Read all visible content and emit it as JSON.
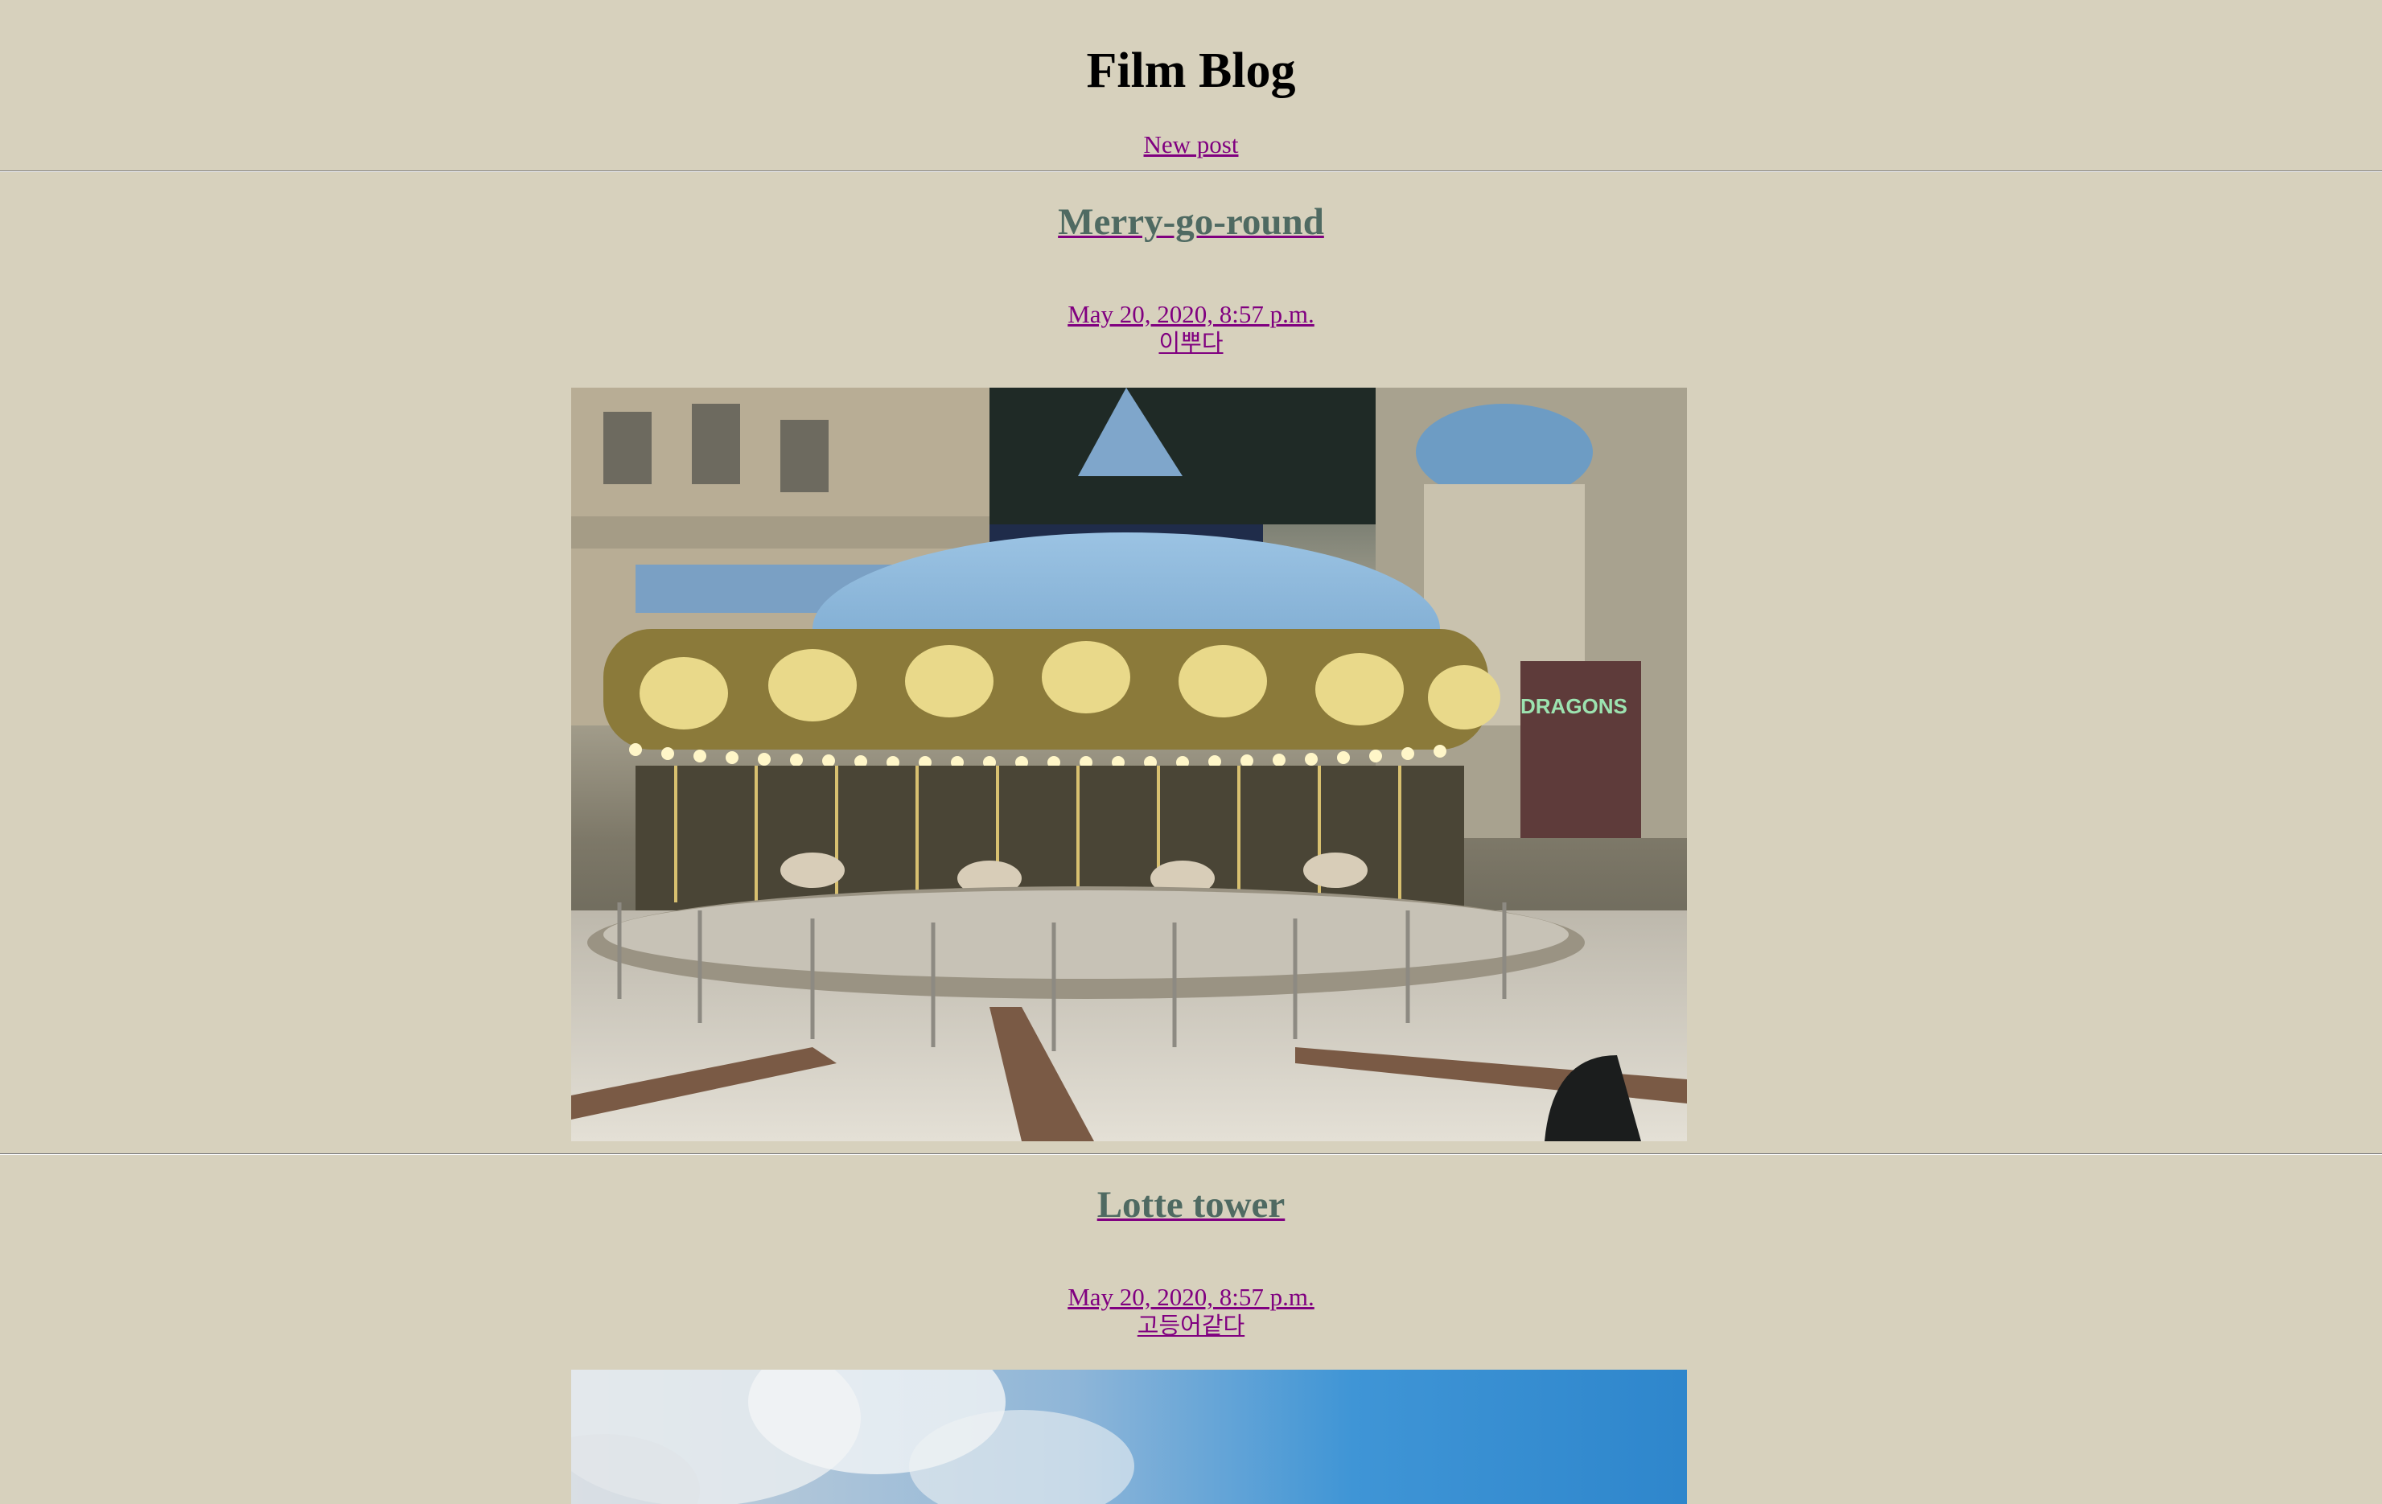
{
  "site": {
    "title": "Film Blog",
    "new_post_label": "New post"
  },
  "posts": [
    {
      "title": "Merry-go-round",
      "date": "May 20, 2020, 8:57 p.m.",
      "caption": "이뿌다",
      "photo_alt": "carousel"
    },
    {
      "title": "Lotte tower",
      "date": "May 20, 2020, 8:57 p.m.",
      "caption": "고등어같다",
      "photo_alt": "sky"
    }
  ],
  "colors": {
    "background": "#d7d1bd",
    "link": "#800080",
    "post_title": "#4f6a62"
  }
}
